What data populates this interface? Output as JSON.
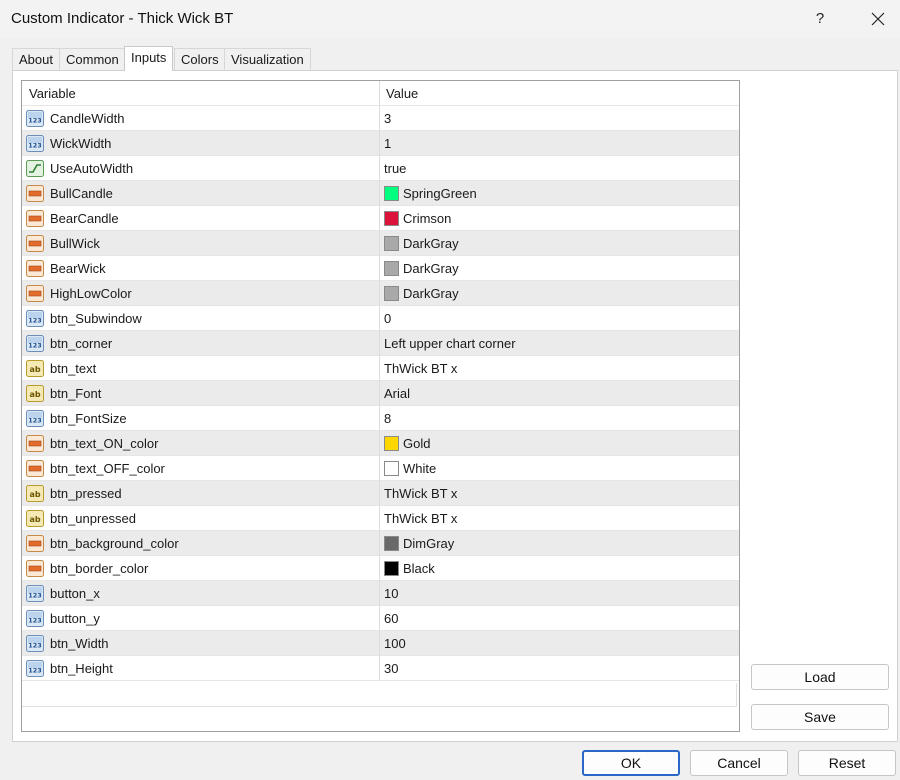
{
  "window": {
    "title": "Custom Indicator - Thick Wick BT",
    "help": "?"
  },
  "tabs": [
    "About",
    "Common",
    "Inputs",
    "Colors",
    "Visualization"
  ],
  "grid": {
    "header_variable": "Variable",
    "header_value": "Value",
    "rows": [
      {
        "name": "CandleWidth",
        "value": "3",
        "icon": "integer-icon"
      },
      {
        "name": "WickWidth",
        "value": "1",
        "icon": "integer-icon"
      },
      {
        "name": "UseAutoWidth",
        "value": "true",
        "icon": "boolean-icon"
      },
      {
        "name": "BullCandle",
        "value": "SpringGreen",
        "icon": "color-icon",
        "color": "#00ff7f"
      },
      {
        "name": "BearCandle",
        "value": "Crimson",
        "icon": "color-icon",
        "color": "#dc143c"
      },
      {
        "name": "BullWick",
        "value": "DarkGray",
        "icon": "color-icon",
        "color": "#a9a9a9"
      },
      {
        "name": "BearWick",
        "value": "DarkGray",
        "icon": "color-icon",
        "color": "#a9a9a9"
      },
      {
        "name": "HighLowColor",
        "value": "DarkGray",
        "icon": "color-icon",
        "color": "#a9a9a9"
      },
      {
        "name": "btn_Subwindow",
        "value": "0",
        "icon": "integer-icon"
      },
      {
        "name": "btn_corner",
        "value": "Left upper chart corner",
        "icon": "integer-icon"
      },
      {
        "name": "btn_text",
        "value": "ThWick BT x",
        "icon": "string-icon"
      },
      {
        "name": "btn_Font",
        "value": "Arial",
        "icon": "string-icon"
      },
      {
        "name": "btn_FontSize",
        "value": "8",
        "icon": "integer-icon"
      },
      {
        "name": "btn_text_ON_color",
        "value": "Gold",
        "icon": "color-icon",
        "color": "#ffd700"
      },
      {
        "name": "btn_text_OFF_color",
        "value": "White",
        "icon": "color-icon",
        "color": "#ffffff"
      },
      {
        "name": "btn_pressed",
        "value": "ThWick BT x",
        "icon": "string-icon"
      },
      {
        "name": "btn_unpressed",
        "value": "ThWick BT x",
        "icon": "string-icon"
      },
      {
        "name": "btn_background_color",
        "value": "DimGray",
        "icon": "color-icon",
        "color": "#696969"
      },
      {
        "name": "btn_border_color",
        "value": "Black",
        "icon": "color-icon",
        "color": "#000000"
      },
      {
        "name": "button_x",
        "value": "10",
        "icon": "integer-icon"
      },
      {
        "name": "button_y",
        "value": "60",
        "icon": "integer-icon"
      },
      {
        "name": "btn_Width",
        "value": "100",
        "icon": "integer-icon"
      },
      {
        "name": "btn_Height",
        "value": "30",
        "icon": "integer-icon"
      }
    ]
  },
  "side_buttons": {
    "load": "Load",
    "save": "Save"
  },
  "footer": {
    "ok": "OK",
    "cancel": "Cancel",
    "reset": "Reset"
  }
}
